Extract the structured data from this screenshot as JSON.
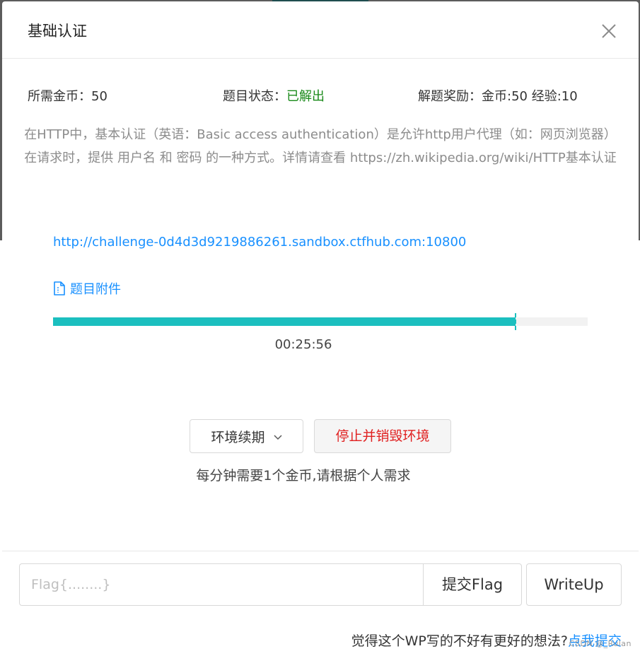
{
  "modal": {
    "title": "基础认证",
    "close_label": "×"
  },
  "info": {
    "cost_label": "所需金币：",
    "cost_value": "50",
    "status_label": "题目状态：",
    "status_value": "已解出",
    "reward_label": "解题奖励：",
    "reward_value": "金币:50 经验:10"
  },
  "description": "在HTTP中，基本认证（英语：Basic access authentication）是允许http用户代理（如：网页浏览器）在请求时，提供 用户名 和 密码 的一种方式。详情请查看 https://zh.wikipedia.org/wiki/HTTP基本认证",
  "challenge_url": "http://challenge-0d4d3d9219886261.sandbox.ctfhub.com:10800",
  "attachment": {
    "label": "题目附件",
    "icon": "file-icon"
  },
  "timer": {
    "remaining": "00:25:56",
    "progress_fraction": 0.865
  },
  "environment": {
    "renew_label": "环境续期",
    "destroy_label": "停止并销毁环境",
    "coin_note": "每分钟需要1个金币,请根据个人需求"
  },
  "flag": {
    "placeholder": "Flag{........}",
    "submit_label": "提交Flag",
    "writeup_label": "WriteUp"
  },
  "feedback": {
    "text": "觉得这个WP写的不好有更好的想法?",
    "link_label": "点我提交"
  },
  "watermark": "CSDN @_Rulan",
  "colors": {
    "accent": "#1890ff",
    "progress": "#1bbfbf",
    "solved": "#1a8a1a",
    "danger": "#e02020"
  }
}
